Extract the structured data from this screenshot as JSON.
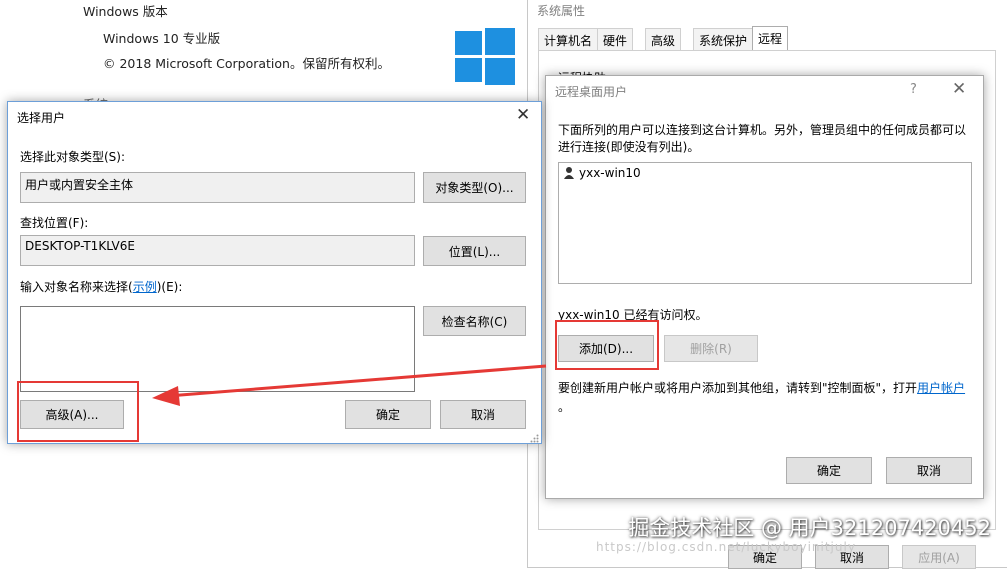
{
  "background": {
    "windows_version_heading": "Windows 版本",
    "edition": "Windows 10 专业版",
    "copyright": "© 2018 Microsoft Corporation。保留所有权利。",
    "partial_text": "系统"
  },
  "system_properties": {
    "title": "系统属性",
    "tabs": [
      "计算机名",
      "硬件",
      "高级",
      "系统保护",
      "远程"
    ],
    "active_tab": "远程",
    "partial_section": "远程协助",
    "bottom_buttons": [
      "确定",
      "取消",
      "应用(A)"
    ]
  },
  "remote_desktop_users": {
    "title": "远程桌面用户",
    "help_icon": "?",
    "description": "下面所列的用户可以连接到这台计算机。另外，管理员组中的任何成员都可以进行连接(即使没有列出)。",
    "users": [
      "yxx-win10"
    ],
    "access_status": "yxx-win10 已经有访问权。",
    "add_button": "添加(D)...",
    "remove_button": "删除(R)",
    "hint_prefix": "要创建新用户帐户或将用户添加到其他组，请转到\"控制面板\"，打开",
    "hint_link": "用户帐户",
    "hint_suffix": "。",
    "ok_button": "确定",
    "cancel_button": "取消"
  },
  "select_users": {
    "title": "选择用户",
    "object_type_label": "选择此对象类型(S):",
    "object_type_value": "用户或内置安全主体",
    "object_types_button": "对象类型(O)...",
    "location_label": "查找位置(F):",
    "location_value": "DESKTOP-T1KLV6E",
    "location_button": "位置(L)...",
    "enter_names_label_prefix": "输入对象名称来选择(",
    "enter_names_link": "示例",
    "enter_names_label_suffix": ")(E):",
    "check_names_button": "检查名称(C)",
    "advanced_button": "高级(A)...",
    "ok_button": "确定",
    "cancel_button": "取消"
  },
  "watermark": {
    "text": "掘金技术社区 @ 用户321207420452",
    "url_faint": "https://blog.csdn.net/luckyboyinitjuly"
  },
  "colors": {
    "annotation_red": "#e53935",
    "window_border": "#6d9fd8",
    "windows_logo": "#1e90e0"
  }
}
